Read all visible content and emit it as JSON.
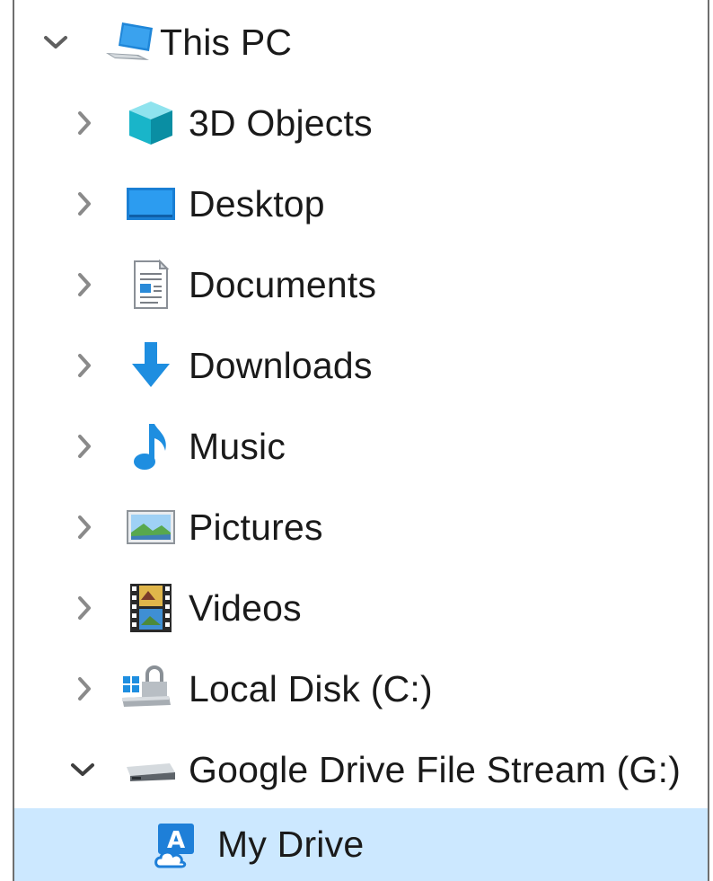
{
  "tree": {
    "root": {
      "label": "This PC",
      "icon": "this-pc-icon",
      "expanded": true
    },
    "items": [
      {
        "label": "3D Objects",
        "icon": "3d-objects-icon",
        "expanded": false
      },
      {
        "label": "Desktop",
        "icon": "desktop-icon",
        "expanded": false
      },
      {
        "label": "Documents",
        "icon": "documents-icon",
        "expanded": false
      },
      {
        "label": "Downloads",
        "icon": "downloads-icon",
        "expanded": false
      },
      {
        "label": "Music",
        "icon": "music-icon",
        "expanded": false
      },
      {
        "label": "Pictures",
        "icon": "pictures-icon",
        "expanded": false
      },
      {
        "label": "Videos",
        "icon": "videos-icon",
        "expanded": false
      },
      {
        "label": "Local Disk (C:)",
        "icon": "local-disk-icon",
        "expanded": false
      },
      {
        "label": "Google Drive File Stream (G:)",
        "icon": "network-drive-icon",
        "expanded": true
      }
    ],
    "child": {
      "label": "My Drive",
      "icon": "my-drive-icon",
      "selected": true
    }
  },
  "colors": {
    "selection": "#cce8ff",
    "chevron": "#5f5f5f",
    "text": "#1a1a1a",
    "accent_blue": "#1e8ee0"
  }
}
